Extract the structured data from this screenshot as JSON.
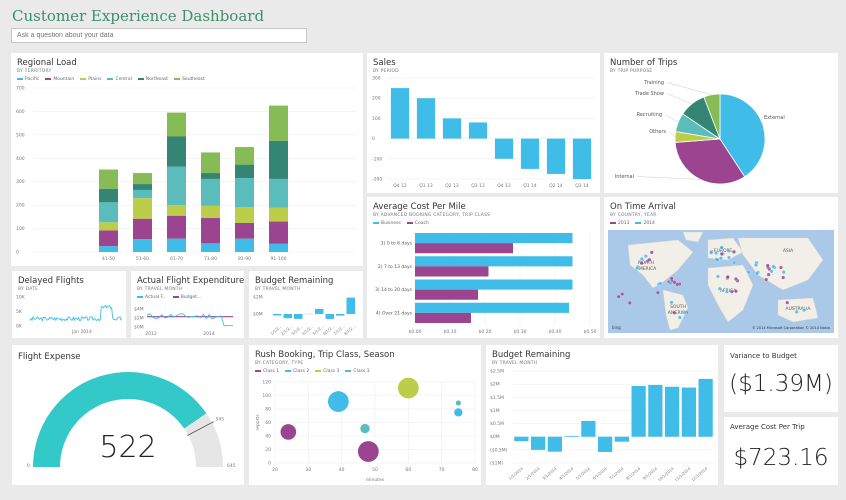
{
  "header": {
    "title": "Customer Experience Dashboard",
    "qa_placeholder": "Ask a question about your data"
  },
  "colors": {
    "pacific": "#3fbde8",
    "mountain": "#9b4590",
    "plains": "#bccd4a",
    "central": "#5bbcbc",
    "northeast": "#348573",
    "southeast": "#87bb55",
    "gauge_fill": "#33c9c9",
    "gauge_bg": "#e6e6e6",
    "title_green": "#3e8f6e"
  },
  "tiles": {
    "regional_load": {
      "title": "Regional Load",
      "subtitle": "BY TERRITORY"
    },
    "sales": {
      "title": "Sales",
      "subtitle": "BY PERIOD"
    },
    "trips": {
      "title": "Number of Trips",
      "subtitle": "BY TRIP PURPOSE"
    },
    "cost_per_mile": {
      "title": "Average Cost Per Mile",
      "subtitle": "BY ADVANCED BOOKING CATEGORY, TRIP CLASS"
    },
    "on_time": {
      "title": "On Time Arrival",
      "subtitle": "BY COUNTRY, YEAR",
      "legend": [
        "2013",
        "2014"
      ],
      "map_labels": [
        "NORTH",
        "AMERICA",
        "EUROPE",
        "ASIA",
        "AFRICA",
        "SOUTH",
        "AMERICA",
        "AUSTRALIA"
      ],
      "attribution": "© 2014 Microsoft Corporation   © 2014 Nokia",
      "bing": "bing"
    },
    "delayed": {
      "title": "Delayed Flights",
      "subtitle": "BY DATE",
      "y_ticks": [
        "10K",
        "5K",
        "0K"
      ],
      "x_label": "Jan 2014"
    },
    "actual_exp": {
      "title": "Actual Flight Expenditures, Bu...",
      "subtitle": "BY TRAVEL MONTH",
      "legend": [
        "Actual F...",
        "Budget..."
      ],
      "y_ticks": [
        "$4M",
        "$2M",
        "$0M"
      ],
      "x_ticks": [
        "2012",
        "2014"
      ]
    },
    "budget_small": {
      "title": "Budget Remaining",
      "subtitle": "BY TRAVEL MONTH",
      "y_ticks": [
        "$2M",
        "$0M"
      ],
      "x_ticks": [
        "1/1/2...",
        "2/1/2...",
        "3/1/2...",
        "4/1/2...",
        "5/1/2...",
        "6/1/2...",
        "7/1/2...",
        "8/1/2..."
      ]
    },
    "flight_expense": {
      "title": "Flight Expense",
      "value": "522",
      "min": "0",
      "max": "645",
      "target": "545"
    },
    "rush": {
      "title": "Rush Booking, Trip Class, Season",
      "subtitle": "BY CATEGORY, TYPE"
    },
    "budget_large": {
      "title": "Budget Remaining",
      "subtitle": "BY TRAVEL MONTH"
    },
    "variance": {
      "title": "Variance to Budget",
      "value": "($1.39M)"
    },
    "avg_cost_trip": {
      "title": "Average Cost Per Trip",
      "value": "$723.16"
    }
  },
  "chart_data": [
    {
      "id": "regional_load",
      "type": "bar",
      "stacked": true,
      "title": "Regional Load",
      "categories": [
        "41-50",
        "51-60",
        "61-70",
        "71-80",
        "81-90",
        "91-100"
      ],
      "series": [
        {
          "name": "Pacific",
          "values": [
            25,
            55,
            57,
            37,
            57,
            35
          ]
        },
        {
          "name": "Mountain",
          "values": [
            67,
            87,
            98,
            108,
            67,
            95
          ]
        },
        {
          "name": "Plains",
          "values": [
            35,
            88,
            45,
            52,
            67,
            60
          ]
        },
        {
          "name": "Central",
          "values": [
            85,
            35,
            165,
            115,
            125,
            122
          ]
        },
        {
          "name": "Northeast",
          "values": [
            58,
            25,
            128,
            25,
            57,
            163
          ]
        },
        {
          "name": "Southeast",
          "values": [
            82,
            47,
            102,
            88,
            75,
            150
          ]
        }
      ],
      "ylim": [
        0,
        700
      ],
      "y_ticks": [
        0,
        100,
        200,
        300,
        400,
        500,
        600,
        700
      ],
      "legend": "top-left",
      "grid": true
    },
    {
      "id": "sales",
      "type": "bar",
      "title": "Sales",
      "categories": [
        "Q4 12",
        "Q1 13",
        "Q2 13",
        "Q3 13",
        "Q4 13",
        "Q1 14",
        "Q2 14",
        "Q3 14"
      ],
      "values": [
        250,
        200,
        100,
        80,
        -100,
        -150,
        -175,
        -200
      ],
      "ylim": [
        -200,
        300
      ],
      "y_ticks": [
        300,
        200,
        100,
        0,
        -100,
        -200
      ],
      "grid": true
    },
    {
      "id": "trips",
      "type": "pie",
      "title": "Number of Trips",
      "categories": [
        "External",
        "Internal",
        "Others",
        "Recruiting",
        "Trade Show",
        "Training"
      ],
      "values": [
        42,
        34,
        4,
        7,
        10,
        6
      ]
    },
    {
      "id": "cost_per_mile",
      "type": "bar",
      "orientation": "horizontal",
      "title": "Average Cost Per Mile",
      "categories": [
        "1) 0 to 6 days",
        "2) 7 to 13 days",
        "3) 14 to 20 days",
        "4) Over 21 days"
      ],
      "series": [
        {
          "name": "Business",
          "values": [
            0.45,
            0.45,
            0.45,
            0.44
          ]
        },
        {
          "name": "Coach",
          "values": [
            0.28,
            0.21,
            0.18,
            0.16
          ]
        }
      ],
      "xlim": [
        0,
        0.5
      ],
      "x_ticks": [
        "$0.00",
        "$0.10",
        "$0.20",
        "$0.30",
        "$0.40",
        "$0.50"
      ],
      "legend": "top-left"
    },
    {
      "id": "rush",
      "type": "scatter",
      "title": "Rush Booking, Trip Class, Season",
      "xlabel": "minutes",
      "ylabel": "reports",
      "xlim": [
        20,
        80
      ],
      "ylim": [
        0,
        120
      ],
      "x_ticks": [
        20,
        30,
        40,
        50,
        60,
        70,
        80
      ],
      "y_ticks": [
        0,
        20,
        40,
        60,
        80,
        100,
        120
      ],
      "legend": [
        "Class 1",
        "Class 2",
        "Class 3",
        "Class 3"
      ],
      "points": [
        {
          "series": "Class 1",
          "x": 24,
          "y": 46,
          "size": 3
        },
        {
          "series": "Class 1",
          "x": 48,
          "y": 17,
          "size": 4
        },
        {
          "series": "Class 2",
          "x": 39,
          "y": 91,
          "size": 4
        },
        {
          "series": "Class 2",
          "x": 75,
          "y": 75,
          "size": 1.6
        },
        {
          "series": "Class 3",
          "x": 60,
          "y": 111,
          "size": 4
        },
        {
          "series": "Class 3b",
          "x": 47,
          "y": 51,
          "size": 1.8
        },
        {
          "series": "Class 3b",
          "x": 75,
          "y": 89,
          "size": 1
        }
      ]
    },
    {
      "id": "budget_large",
      "type": "bar",
      "title": "Budget Remaining",
      "categories": [
        "1/1/2014",
        "2/1/2014",
        "3/1/2014",
        "4/1/2014",
        "5/1/2014",
        "6/1/2014",
        "7/1/2014",
        "8/1/2014",
        "9/1/2014",
        "10/1/2014",
        "11/1/2014",
        "12/1/2014"
      ],
      "values": [
        -0.17,
        -0.5,
        -0.57,
        0.03,
        0.6,
        -0.58,
        -0.19,
        1.93,
        1.97,
        1.9,
        1.87,
        2.2
      ],
      "ylim": [
        -1,
        2.5
      ],
      "y_ticks": [
        "$2.5M",
        "$2M",
        "$1.5M",
        "$1M",
        "$0.5M",
        "$0M",
        "($0.5M)",
        "($1M)"
      ],
      "grid": true
    },
    {
      "id": "budget_small",
      "type": "bar",
      "title": "Budget Remaining",
      "categories": [
        "1/1/2...",
        "2/1/2...",
        "3/1/2...",
        "4/1/2...",
        "5/1/2...",
        "6/1/2...",
        "7/1/2...",
        "8/1/2..."
      ],
      "values": [
        -0.17,
        -0.5,
        -0.57,
        0.03,
        0.6,
        -0.58,
        -0.19,
        1.93
      ],
      "ylim": [
        -1,
        2
      ]
    },
    {
      "id": "flight_expense",
      "type": "gauge",
      "value": 522,
      "min": 0,
      "max": 645,
      "target": 545
    },
    {
      "id": "delayed",
      "type": "line",
      "title": "Delayed Flights",
      "ylim": [
        0,
        10000
      ],
      "description": "daily series ~2.5K, rising to ~7K late then falling to ~2.5K"
    },
    {
      "id": "actual_exp",
      "type": "line",
      "series": [
        {
          "name": "Actual F...",
          "description": "fluctuates ~$2-3M, drops to ~$0.3M at end"
        },
        {
          "name": "Budget...",
          "description": "flat ~$2.3M"
        }
      ],
      "ylim": [
        0,
        4
      ]
    }
  ]
}
